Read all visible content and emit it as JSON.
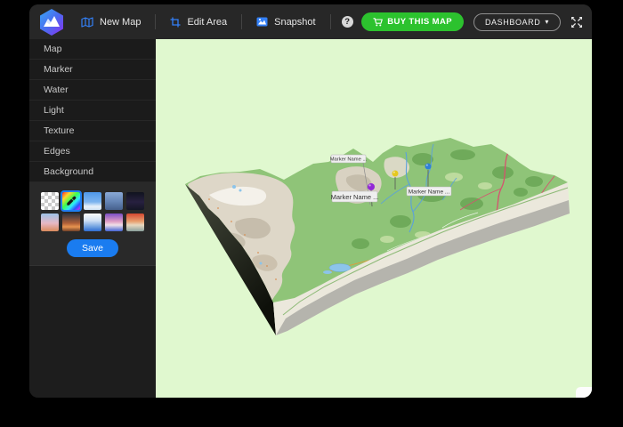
{
  "toolbar": {
    "logo": "mountain-hexagon-logo",
    "menu_items": [
      {
        "label": "New Map",
        "icon": "map-icon"
      },
      {
        "label": "Edit Area",
        "icon": "crop-icon"
      },
      {
        "label": "Snapshot",
        "icon": "snapshot-icon"
      }
    ],
    "help_glyph": "?",
    "buy_button_label": "BUY THIS MAP",
    "dashboard_label": "DASHBOARD",
    "dashboard_caret": "▾",
    "accent_blue": "#3380f7",
    "buy_green": "#2cc22e"
  },
  "sidebar": {
    "items": [
      {
        "label": "Map"
      },
      {
        "label": "Marker"
      },
      {
        "label": "Water"
      },
      {
        "label": "Light"
      },
      {
        "label": "Texture"
      },
      {
        "label": "Edges"
      },
      {
        "label": "Background",
        "expanded": true
      }
    ],
    "background_panel": {
      "swatches": [
        {
          "name": "transparent-checkerboard",
          "selected": false
        },
        {
          "name": "color-picker-rainbow",
          "selected": true
        },
        {
          "name": "blue-sky-clouds",
          "selected": false
        },
        {
          "name": "overcast-blue-sky",
          "selected": false
        },
        {
          "name": "night-sky",
          "selected": false
        },
        {
          "name": "pastel-sunset",
          "selected": false
        },
        {
          "name": "orange-dusk",
          "selected": false
        },
        {
          "name": "white-to-blue-gradient",
          "selected": false
        },
        {
          "name": "purple-pink-blue-gradient",
          "selected": false
        },
        {
          "name": "red-to-teal-gradient",
          "selected": false
        }
      ],
      "save_label": "Save",
      "save_color": "#1a7cf0"
    }
  },
  "map_view": {
    "background_color": "#e0f8cf",
    "marker_labels": [
      "Marker Name ...",
      "Marker Name ...",
      "Marker Name ..."
    ],
    "pins": [
      {
        "name": "purple-pin",
        "color": "#9327d6"
      },
      {
        "name": "yellow-pin",
        "color": "#e6c81f"
      },
      {
        "name": "blue-pin",
        "color": "#2f80d6"
      }
    ],
    "terrain_colors": {
      "surface_green": "#8fc478",
      "rock": "#ded7c8",
      "cliff_dark": "#14160e",
      "sediment_cream": "#ebe8dc",
      "sediment_gray": "#b5b4ad"
    }
  }
}
